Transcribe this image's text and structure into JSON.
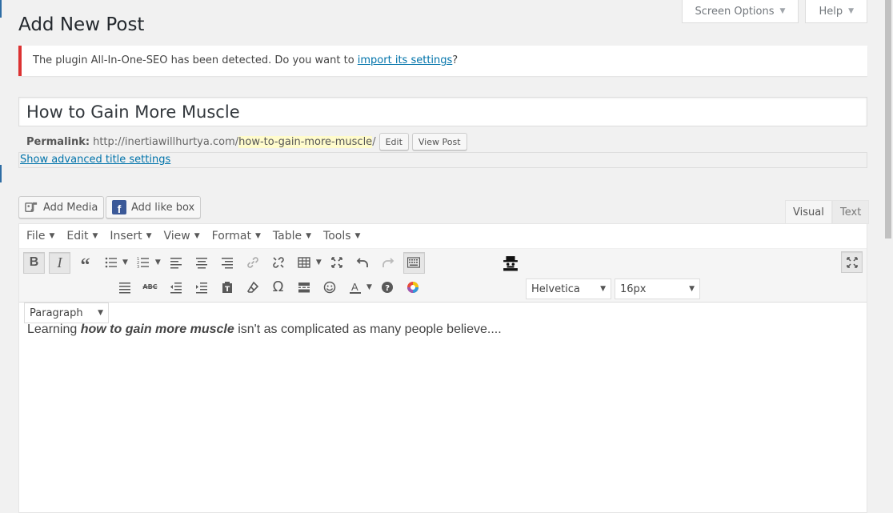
{
  "page": {
    "title": "Add New Post"
  },
  "screen_meta": {
    "screen_options": "Screen Options",
    "help": "Help"
  },
  "notice": {
    "text_before": "The plugin All-In-One-SEO has been detected. Do you want to ",
    "link": "import its settings",
    "text_after": "?"
  },
  "post": {
    "title": "How to Gain More Muscle"
  },
  "permalink": {
    "label": "Permalink:",
    "base": "http://inertiawillhurtya.com/",
    "slug": "how-to-gain-more-muscle",
    "trailing": "/",
    "edit_label": "Edit",
    "view_label": "View Post"
  },
  "advanced_title": {
    "link": "Show advanced title settings"
  },
  "media_buttons": {
    "add_media": "Add Media",
    "add_like_box": "Add like box"
  },
  "editor_tabs": {
    "visual": "Visual",
    "text": "Text"
  },
  "menubar": [
    "File",
    "Edit",
    "Insert",
    "View",
    "Format",
    "Table",
    "Tools"
  ],
  "toolbar": {
    "font_family": "Helvetica",
    "font_size": "16px",
    "block_format": "Paragraph"
  },
  "content": {
    "before": "Learning ",
    "bold_italic": "how to gain more muscle",
    "after": " isn't as complicated as many people believe...."
  },
  "colors": {
    "notice_border": "#dc3232",
    "link": "#0073aa",
    "slug_highlight": "#fffbcc"
  }
}
